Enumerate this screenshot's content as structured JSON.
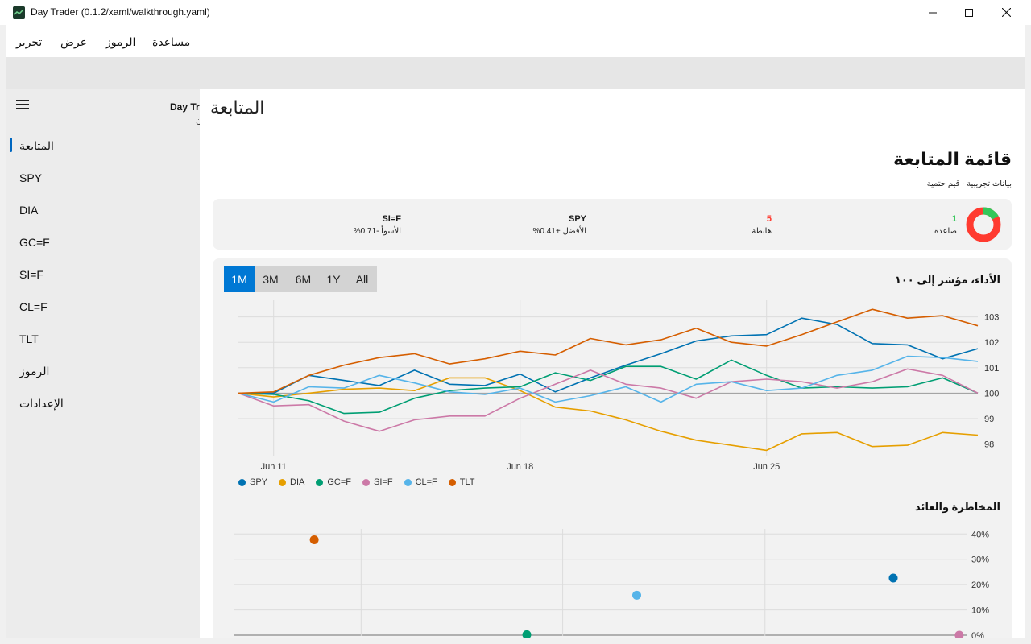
{
  "window": {
    "title": "Day Trader (0.1.2/xaml/walkthrough.yaml)"
  },
  "menu": [
    "تحرير",
    "عرض",
    "الرموز",
    "مساعدة"
  ],
  "sidebar": {
    "items": [
      "المتابعة",
      "SPY",
      "DIA",
      "GC=F",
      "SI=F",
      "CL=F",
      "TLT",
      "الرموز",
      "الإعدادات"
    ],
    "selected": 0,
    "peek_title": "Day Tr",
    "peek_sub": "ن"
  },
  "page": {
    "title": "المتابعة",
    "heading": "قائمة المتابعة",
    "subheading": "بيانات تجريبية · قيم حتمية"
  },
  "summary": {
    "up_count": "1",
    "up_label": "صاعدة",
    "down_count": "5",
    "down_label": "هابطة",
    "best_symbol": "SPY",
    "best_label": "الأفضل +0.41%",
    "worst_symbol": "SI=F",
    "worst_label": "الأسوأ -0.71%",
    "colors": {
      "up": "#34c759",
      "down": "#ff3b30"
    }
  },
  "performance": {
    "title": "الأداء، مؤشر إلى ١٠٠",
    "ranges": [
      "1M",
      "3M",
      "6M",
      "1Y",
      "All"
    ],
    "active_range": "1M"
  },
  "risk": {
    "title": "المخاطرة والعائد"
  },
  "chart_data": [
    {
      "type": "line",
      "title": "الأداء، مؤشر إلى ١٠٠",
      "x": [
        0,
        1,
        2,
        3,
        4,
        5,
        6,
        7,
        8,
        9,
        10,
        11,
        12,
        13,
        14,
        15,
        16,
        17,
        18,
        19,
        20,
        21
      ],
      "x_ticks": [
        {
          "at": 1,
          "label": "Jun 11"
        },
        {
          "at": 8,
          "label": "Jun 18"
        },
        {
          "at": 15,
          "label": "Jun 25"
        }
      ],
      "ylim": [
        97.7,
        103.4
      ],
      "y_ticks": [
        98,
        99,
        100,
        101,
        102,
        103
      ],
      "grid": true,
      "legend": "bottom-left",
      "series": [
        {
          "name": "SPY",
          "color": "#0072b2",
          "values": [
            100,
            100,
            100.7,
            100.5,
            100.3,
            100.9,
            100.35,
            100.3,
            100.75,
            100.05,
            100.6,
            101.1,
            101.55,
            102.05,
            102.25,
            102.3,
            102.95,
            102.7,
            101.95,
            101.9,
            101.35,
            101.75
          ]
        },
        {
          "name": "DIA",
          "color": "#e69f00",
          "values": [
            100,
            99.85,
            100,
            100.15,
            100.2,
            100.1,
            100.6,
            100.6,
            100.1,
            99.45,
            99.3,
            98.95,
            98.5,
            98.15,
            97.95,
            97.75,
            98.4,
            98.45,
            97.9,
            97.95,
            98.45,
            98.35
          ]
        },
        {
          "name": "GC=F",
          "color": "#009e73",
          "values": [
            100,
            99.95,
            99.7,
            99.2,
            99.25,
            99.8,
            100.1,
            100.2,
            100.25,
            100.8,
            100.5,
            101.05,
            101.05,
            100.55,
            101.3,
            100.7,
            100.2,
            100.25,
            100.2,
            100.25,
            100.6,
            100
          ]
        },
        {
          "name": "SI=F",
          "color": "#cc79a7",
          "values": [
            100,
            99.5,
            99.55,
            98.9,
            98.5,
            98.95,
            99.1,
            99.1,
            99.8,
            100.35,
            100.9,
            100.35,
            100.2,
            99.8,
            100.45,
            100.55,
            100.45,
            100.2,
            100.45,
            100.95,
            100.7,
            100
          ]
        },
        {
          "name": "CL=F",
          "color": "#56b4e9",
          "values": [
            100,
            99.65,
            100.25,
            100.2,
            100.7,
            100.4,
            100.05,
            99.95,
            100.2,
            99.65,
            99.9,
            100.25,
            99.65,
            100.35,
            100.45,
            100.1,
            100.2,
            100.7,
            100.9,
            101.45,
            101.4,
            101.25
          ]
        },
        {
          "name": "TLT",
          "color": "#d55e00",
          "values": [
            100,
            100.05,
            100.7,
            101.1,
            101.4,
            101.55,
            101.15,
            101.35,
            101.65,
            101.5,
            102.15,
            101.9,
            102.1,
            102.55,
            102,
            101.85,
            102.3,
            102.8,
            103.3,
            102.95,
            103.05,
            102.65
          ]
        }
      ]
    },
    {
      "type": "scatter",
      "title": "المخاطرة والعائد",
      "ylim": [
        -0.3,
        42
      ],
      "xlim": [
        0,
        1
      ],
      "y_ticks": [
        "0%",
        "10%",
        "20%",
        "30%",
        "40%"
      ],
      "y_tick_values": [
        0,
        10,
        20,
        30,
        40
      ],
      "grid": true,
      "points": [
        {
          "name": "TLT",
          "color": "#d55e00",
          "x": 0.11,
          "y": 37.7
        },
        {
          "name": "CL=F",
          "color": "#56b4e9",
          "x": 0.55,
          "y": 15.8
        },
        {
          "name": "SPY",
          "color": "#0072b2",
          "x": 0.9,
          "y": 22.6
        },
        {
          "name": "GC=F",
          "color": "#009e73",
          "x": 0.4,
          "y": 0.2
        },
        {
          "name": "SI=F",
          "color": "#cc79a7",
          "x": 0.99,
          "y": 0
        }
      ]
    }
  ]
}
